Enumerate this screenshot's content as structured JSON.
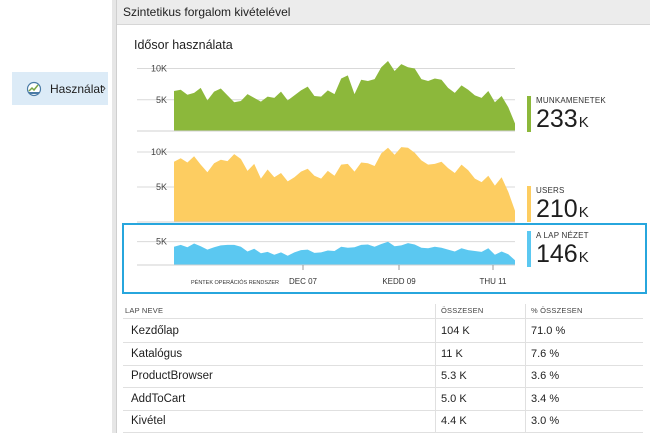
{
  "nav": {
    "item_label": "Használat",
    "item_icon": "usage-icon",
    "chevron": "›"
  },
  "blade": {
    "title": "Szintetikus forgalom kivételével"
  },
  "chart_data": {
    "type": "area",
    "title": "Idősor használata",
    "x_tick_labels": [
      "PÉNTEK OPERÁCIÓS RENDSZER",
      "DEC 07",
      "KEDD 09",
      "THU 11"
    ],
    "panels": [
      {
        "name": "MUNKAMENETEK",
        "total": "233",
        "unit": "K",
        "color": "#8cb83b",
        "ylim": [
          0,
          12000
        ],
        "yticks": [
          "10K",
          "5K"
        ],
        "values": [
          6400,
          6600,
          5800,
          6100,
          6900,
          4900,
          6300,
          6800,
          5700,
          4600,
          4800,
          5900,
          5300,
          4700,
          5500,
          5300,
          6300,
          4900,
          5700,
          6500,
          7100,
          5600,
          5500,
          6500,
          5900,
          8400,
          8900,
          5900,
          8200,
          8000,
          8300,
          10200,
          11200,
          9600,
          10700,
          10200,
          10000,
          8300,
          8000,
          8400,
          8200,
          6900,
          6100,
          7300,
          6600,
          5700,
          5300,
          6400,
          4600,
          5600,
          3800,
          1200
        ]
      },
      {
        "name": "USERS",
        "total": "210",
        "unit": "K",
        "color": "#fdcd61",
        "ylim": [
          0,
          12000
        ],
        "yticks": [
          "10K",
          "5K"
        ],
        "values": [
          8600,
          9100,
          8500,
          9400,
          8200,
          7100,
          8400,
          8900,
          8700,
          9700,
          9000,
          7300,
          8300,
          6200,
          7500,
          6400,
          7000,
          5800,
          6400,
          7200,
          7600,
          6600,
          6200,
          7300,
          6600,
          8200,
          8300,
          7200,
          8500,
          8400,
          8000,
          9800,
          10600,
          9600,
          10700,
          10600,
          9900,
          8800,
          8200,
          8300,
          8600,
          7700,
          7000,
          8200,
          7400,
          6200,
          5700,
          6600,
          5200,
          6400,
          4300,
          1600
        ]
      },
      {
        "name": "A LAP NÉZET",
        "total": "146",
        "unit": "K",
        "color": "#5bc8f1",
        "ylim": [
          0,
          7500
        ],
        "yticks": [
          "5K"
        ],
        "values": [
          3900,
          4300,
          3800,
          4600,
          4000,
          3300,
          3800,
          4200,
          4300,
          4300,
          3900,
          2900,
          3500,
          2500,
          2800,
          2200,
          2700,
          2000,
          2700,
          3200,
          3300,
          2600,
          2700,
          3100,
          3000,
          3900,
          3700,
          3800,
          4300,
          4400,
          3900,
          4500,
          5000,
          4000,
          4200,
          4700,
          4400,
          3700,
          3600,
          3900,
          3700,
          3300,
          2900,
          3600,
          3200,
          3000,
          2800,
          3600,
          2200,
          2900,
          2300,
          1000
        ]
      }
    ]
  },
  "grid": {
    "headers": [
      "LAP NEVE",
      "ÖSSZESEN",
      "% ÖSSZESEN"
    ],
    "rows": [
      {
        "name": "Kezdőlap",
        "total": "104 K",
        "pct": "71.0 %"
      },
      {
        "name": "Katalógus",
        "total": "11 K",
        "pct": "7.6 %"
      },
      {
        "name": "ProductBrowser",
        "total": "5.3 K",
        "pct": "3.6 %"
      },
      {
        "name": "AddToCart",
        "total": "5.0 K",
        "pct": "3.4 %"
      },
      {
        "name": "Kivétel",
        "total": "4.4 K",
        "pct": "3.0 %"
      }
    ]
  }
}
